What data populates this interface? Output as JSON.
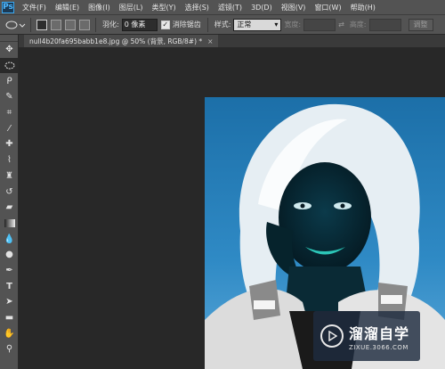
{
  "app": {
    "logo": "Ps"
  },
  "menu": [
    "文件(F)",
    "编辑(E)",
    "图像(I)",
    "图层(L)",
    "类型(Y)",
    "选择(S)",
    "滤镜(T)",
    "3D(D)",
    "视图(V)",
    "窗口(W)",
    "帮助(H)"
  ],
  "options": {
    "feather_label": "羽化:",
    "feather_value": "0 像素",
    "antialias_label": "消除锯齿",
    "antialias_checked": true,
    "style_label": "样式:",
    "style_value": "正常",
    "width_label": "宽度:",
    "height_label": "高度:",
    "adjust_label": "调整"
  },
  "document": {
    "tab_title": "null4b20fa695babb1e8.jpg @ 50% (背景, RGB/8#) *",
    "close_glyph": "×"
  },
  "tools": [
    "move-tool",
    "elliptical-marquee-tool",
    "lasso-tool",
    "quick-selection-tool",
    "crop-tool",
    "eyedropper-tool",
    "spot-healing-tool",
    "brush-tool",
    "clone-stamp-tool",
    "history-brush-tool",
    "eraser-tool",
    "gradient-tool",
    "blur-tool",
    "dodge-tool",
    "pen-tool",
    "type-tool",
    "path-selection-tool",
    "rectangle-tool",
    "hand-tool",
    "zoom-tool"
  ],
  "watermark": {
    "title": "溜溜自学",
    "url": "ZIXUE.3066.COM"
  },
  "colors": {
    "panel_bg": "#535353",
    "canvas_bg": "#282828",
    "accent_blue": "#39a7f0"
  }
}
